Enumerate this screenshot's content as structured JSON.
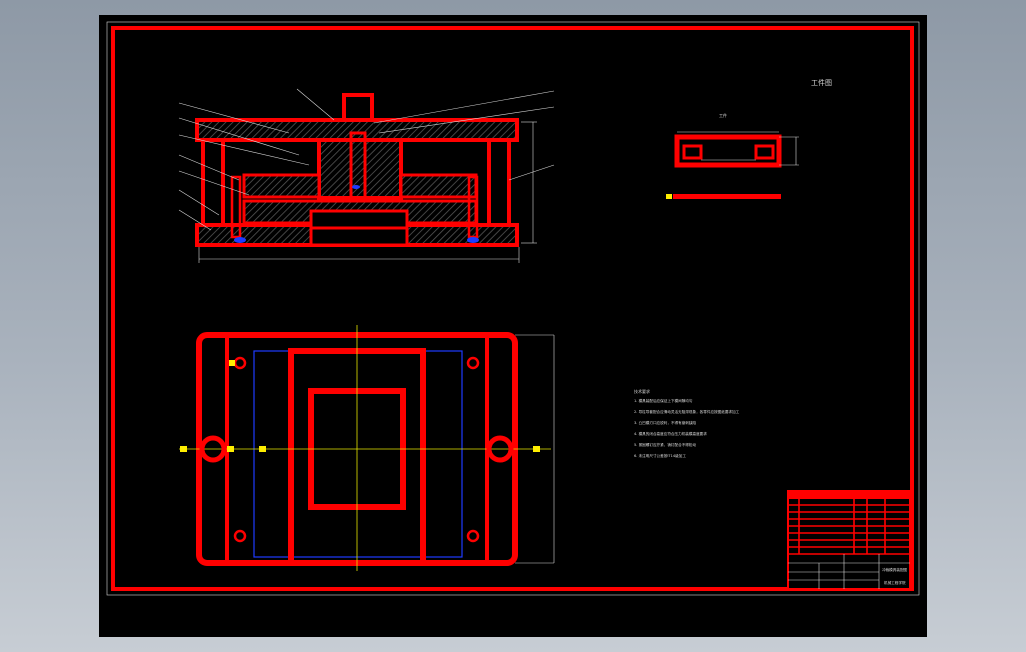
{
  "colors": {
    "background": "#000000",
    "outline": "#ff0000",
    "thin_line": "#d9d9d9",
    "hidden_line": "#1f3bff",
    "center_line": "#e6e600",
    "marker": "#ffee00"
  },
  "drawing": {
    "sheet_label": "工件图",
    "part_view_label": "工件",
    "notes_title": "技术要求",
    "notes": [
      "1. 模具装配后应保证上下模间隙均匀",
      "2. 导柱导套配合应滑动灵活无阻滞现象，各零件应按图纸要求加工",
      "3. 凸凹模刃口应锐利，不得有崩刺缺陷",
      "4. 模具的闭合高度应符合压力机装模高度要求",
      "5. 紧固螺钉应拧紧，销钉配合不得松动",
      "6. 未注明尺寸公差按IT14级加工"
    ],
    "title_block": {
      "drawing_name": "冲裁模具装配图",
      "school": "机械工程学院"
    }
  }
}
